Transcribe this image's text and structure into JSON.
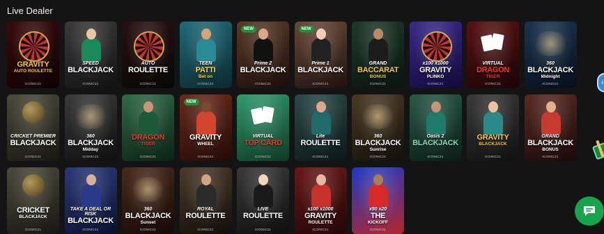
{
  "section": {
    "title": "Live Dealer"
  },
  "tiles": [
    {
      "pre": "",
      "main": "GRAVITY",
      "sub": "AUTO ROULETTE",
      "provider": "ICONIC21",
      "badge": "",
      "bg": "#3a0b0b",
      "bg2": "#0e0202",
      "color": "#f2c64b",
      "art": "wheel",
      "skin": "",
      "outfit": ""
    },
    {
      "pre": "SPEED",
      "main": "BLACKJACK",
      "sub": "",
      "provider": "ICONIC21",
      "badge": "",
      "bg": "#3b3b3b",
      "bg2": "#121212",
      "color": "#ffffff",
      "art": "person",
      "skin": "#e8c4a0",
      "outfit": "#1b8a5a"
    },
    {
      "pre": "AUTO",
      "main": "ROULETTE",
      "sub": "",
      "provider": "ICONIC21",
      "badge": "",
      "bg": "#2a1010",
      "bg2": "#070707",
      "color": "#ffffff",
      "art": "wheel",
      "skin": "",
      "outfit": ""
    },
    {
      "pre": "TEEN",
      "main": "PATTI",
      "sub": "Bet on",
      "provider": "ICONIC21",
      "badge": "",
      "bg": "#1f6b78",
      "bg2": "#0a2a30",
      "color": "#ffd23f",
      "art": "person",
      "skin": "#d9a37a",
      "outfit": "#2a8b95"
    },
    {
      "pre": "Prime 2",
      "main": "BLACKJACK",
      "sub": "",
      "provider": "ICONIC21",
      "badge": "NEW",
      "bg": "#5a3a28",
      "bg2": "#1a0f0a",
      "color": "#ffffff",
      "art": "person",
      "skin": "#d8a98a",
      "outfit": "#111111"
    },
    {
      "pre": "Prime 1",
      "main": "BLACKJACK",
      "sub": "",
      "provider": "ICONIC21",
      "badge": "NEW",
      "bg": "#6a4838",
      "bg2": "#1e130d",
      "color": "#ffffff",
      "art": "person",
      "skin": "#f0d0b8",
      "outfit": "#222222"
    },
    {
      "pre": "GRAND",
      "main": "BACCARAT",
      "sub": "BONUS",
      "provider": "ICONIC21",
      "badge": "",
      "bg": "#1e3a2a",
      "bg2": "#081410",
      "color": "#f2c64b",
      "art": "person",
      "skin": "#b98a66",
      "outfit": "#1c1c1c"
    },
    {
      "pre": "x100 x1000",
      "main": "GRAVITY",
      "sub": "PLINKO",
      "provider": "ICONIC21",
      "badge": "",
      "bg": "#3b2a8a",
      "bg2": "#120a3a",
      "color": "#ffffff",
      "art": "wheel",
      "skin": "",
      "outfit": ""
    },
    {
      "pre": "VIRTUAL",
      "main": "DRAGON",
      "sub": "TIGER",
      "provider": "ICONIC21",
      "badge": "",
      "bg": "#5a1212",
      "bg2": "#1a0404",
      "color": "#e63b2e",
      "art": "cards",
      "skin": "",
      "outfit": ""
    },
    {
      "pre": "360",
      "main": "BLACKJACK",
      "sub": "Midnight",
      "provider": "ICONIC21",
      "badge": "",
      "bg": "#1a3550",
      "bg2": "#060f1a",
      "color": "#ffffff",
      "art": "lights",
      "skin": "",
      "outfit": ""
    },
    {
      "pre": "CRICKET PREMIER",
      "main": "BLACKJACK",
      "sub": "",
      "provider": "ICONIC21",
      "badge": "",
      "bg": "#4a4a3a",
      "bg2": "#181812",
      "color": "#ffffff",
      "art": "ball",
      "skin": "",
      "outfit": ""
    },
    {
      "pre": "360",
      "main": "BLACKJACK",
      "sub": "Midday",
      "provider": "ICONIC21",
      "badge": "",
      "bg": "#3a3a3a",
      "bg2": "#0f0f0f",
      "color": "#ffffff",
      "art": "lights",
      "skin": "",
      "outfit": ""
    },
    {
      "pre": "",
      "main": "DRAGON",
      "sub": "TIGER",
      "provider": "ICONIC21",
      "badge": "",
      "bg": "#2e6b45",
      "bg2": "#0c2216",
      "color": "#e63b2e",
      "art": "person",
      "skin": "#c99477",
      "outfit": "#1a5a36"
    },
    {
      "pre": "",
      "main": "GRAVITY",
      "sub": "WHEEL",
      "provider": "ICONIC21",
      "badge": "NEW",
      "bg": "#6a2a1a",
      "bg2": "#220c06",
      "color": "#ffffff",
      "art": "person",
      "skin": "#7a4a2e",
      "outfit": "#d4452e"
    },
    {
      "pre": "VIRTUAL",
      "main": "TOP CARD",
      "sub": "",
      "provider": "ICONIC21",
      "badge": "",
      "bg": "#2f9a6a",
      "bg2": "#0f3a26",
      "color": "#e63b2e",
      "art": "cards",
      "skin": "",
      "outfit": ""
    },
    {
      "pre": "Lite",
      "main": "ROULETTE",
      "sub": "",
      "provider": "ICONIC21",
      "badge": "",
      "bg": "#2b4a4a",
      "bg2": "#0b1818",
      "color": "#ffffff",
      "art": "person",
      "skin": "#d8a98a",
      "outfit": "#1f6b6b"
    },
    {
      "pre": "360",
      "main": "BLACKJACK",
      "sub": "Sunrise",
      "provider": "ICONIC21",
      "badge": "",
      "bg": "#4a3a22",
      "bg2": "#14100a",
      "color": "#ffffff",
      "art": "lights",
      "skin": "",
      "outfit": ""
    },
    {
      "pre": "Oasis 2",
      "main": "BLACKJACK",
      "sub": "",
      "provider": "ICONIC21",
      "badge": "",
      "bg": "#2a5a4a",
      "bg2": "#0a1c16",
      "color": "#7de0b0",
      "art": "person",
      "skin": "#c49576",
      "outfit": "#1e7b68"
    },
    {
      "pre": "",
      "main": "GRAVITY",
      "sub": "BLACKJACK",
      "provider": "ICONIC21",
      "badge": "",
      "bg": "#3a3a3a",
      "bg2": "#101010",
      "color": "#f2c64b",
      "art": "person",
      "skin": "#eac3a2",
      "outfit": "#2a8a8a"
    },
    {
      "pre": "GRAND",
      "main": "BLACKJACK",
      "sub": "BONUS",
      "provider": "ICONIC21",
      "badge": "",
      "bg": "#5a2a22",
      "bg2": "#1a0a08",
      "color": "#ffffff",
      "art": "person",
      "skin": "#e0b090",
      "outfit": "#c83a2e"
    },
    {
      "pre": "",
      "main": "CRICKET",
      "sub": "BLACKJACK",
      "provider": "ICONIC21",
      "badge": "",
      "bg": "#4a4a3a",
      "bg2": "#181812",
      "color": "#ffffff",
      "art": "ball",
      "skin": "",
      "outfit": ""
    },
    {
      "pre": "TAKE A DEAL OR RISK",
      "main": "BLACKJACK",
      "sub": "",
      "provider": "ICONIC21",
      "badge": "",
      "bg": "#2a3a7a",
      "bg2": "#0a1230",
      "color": "#ffffff",
      "art": "person",
      "skin": "#d8b09a",
      "outfit": "#2a3a8a"
    },
    {
      "pre": "360",
      "main": "BLACKJACK",
      "sub": "Sunset",
      "provider": "ICONIC21",
      "badge": "",
      "bg": "#4a2a1a",
      "bg2": "#140a06",
      "color": "#ffffff",
      "art": "lights",
      "skin": "",
      "outfit": ""
    },
    {
      "pre": "ROYAL",
      "main": "ROULETTE",
      "sub": "",
      "provider": "ICONIC21",
      "badge": "",
      "bg": "#4a3a2a",
      "bg2": "#140f0a",
      "color": "#ffffff",
      "art": "person",
      "skin": "#d4a384",
      "outfit": "#2a2a2a"
    },
    {
      "pre": "LIVE",
      "main": "ROULETTE",
      "sub": "",
      "provider": "ICONIC21",
      "badge": "",
      "bg": "#3a3a3a",
      "bg2": "#0f0f0f",
      "color": "#ffffff",
      "art": "person",
      "skin": "#f0d4c0",
      "outfit": "#1a1a1a"
    },
    {
      "pre": "x100 x1000",
      "main": "GRAVITY",
      "sub": "ROULETTE",
      "provider": "ICONIC21",
      "badge": "",
      "bg": "#6a1818",
      "bg2": "#220606",
      "color": "#ffffff",
      "art": "person",
      "skin": "#e6b9a0",
      "outfit": "#c8302c"
    },
    {
      "pre": "x50 x20",
      "main": "THE",
      "sub": "KICKOFF",
      "provider": "ICONIC21",
      "badge": "",
      "bg": "#1a3ac8",
      "bg2": "#b3262a",
      "color": "#ffffff",
      "art": "person",
      "skin": "#b07a58",
      "outfit": "#d62a2a"
    }
  ],
  "widgets": {
    "side_arrow": "‹",
    "chat_icon": "chat-bubble-icon"
  }
}
